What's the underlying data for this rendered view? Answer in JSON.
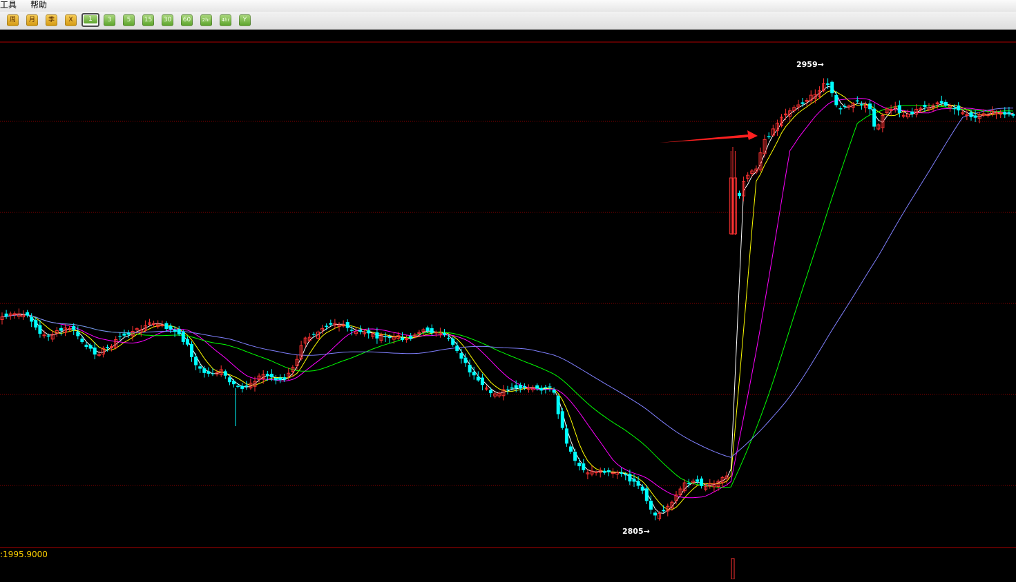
{
  "menu": {
    "items": [
      {
        "label": "工具"
      },
      {
        "label": "帮助"
      }
    ]
  },
  "toolbar": {
    "buttons": [
      {
        "label": "周",
        "style": "amber"
      },
      {
        "label": "月",
        "style": "amber"
      },
      {
        "label": "季",
        "style": "amber"
      },
      {
        "label": "X",
        "style": "amber"
      },
      {
        "label": "1",
        "style": "active"
      },
      {
        "label": "3",
        "style": "green"
      },
      {
        "label": "5",
        "style": "green"
      },
      {
        "label": "15",
        "style": "green"
      },
      {
        "label": "30",
        "style": "green"
      },
      {
        "label": "60",
        "style": "green"
      },
      {
        "label": "2hr",
        "style": "green"
      },
      {
        "label": "4hr",
        "style": "green"
      },
      {
        "label": "Y",
        "style": "green"
      }
    ]
  },
  "chart": {
    "high_label": "2959→",
    "low_label": "2805→",
    "volume_value": ":1995.9000",
    "colors": {
      "up": "#ff3232",
      "down": "#00ffff",
      "ma1": "#ffffff",
      "ma2": "#ffff00",
      "ma3": "#ff00ff",
      "ma4": "#00ff00",
      "ma5": "#8080ff",
      "grid": "#8b0000",
      "arrow": "#ff2020"
    }
  },
  "chart_data": {
    "type": "candlestick",
    "price_high": 2959,
    "price_low": 2805,
    "volume_readout": 1995.9,
    "moving_averages": 5
  }
}
